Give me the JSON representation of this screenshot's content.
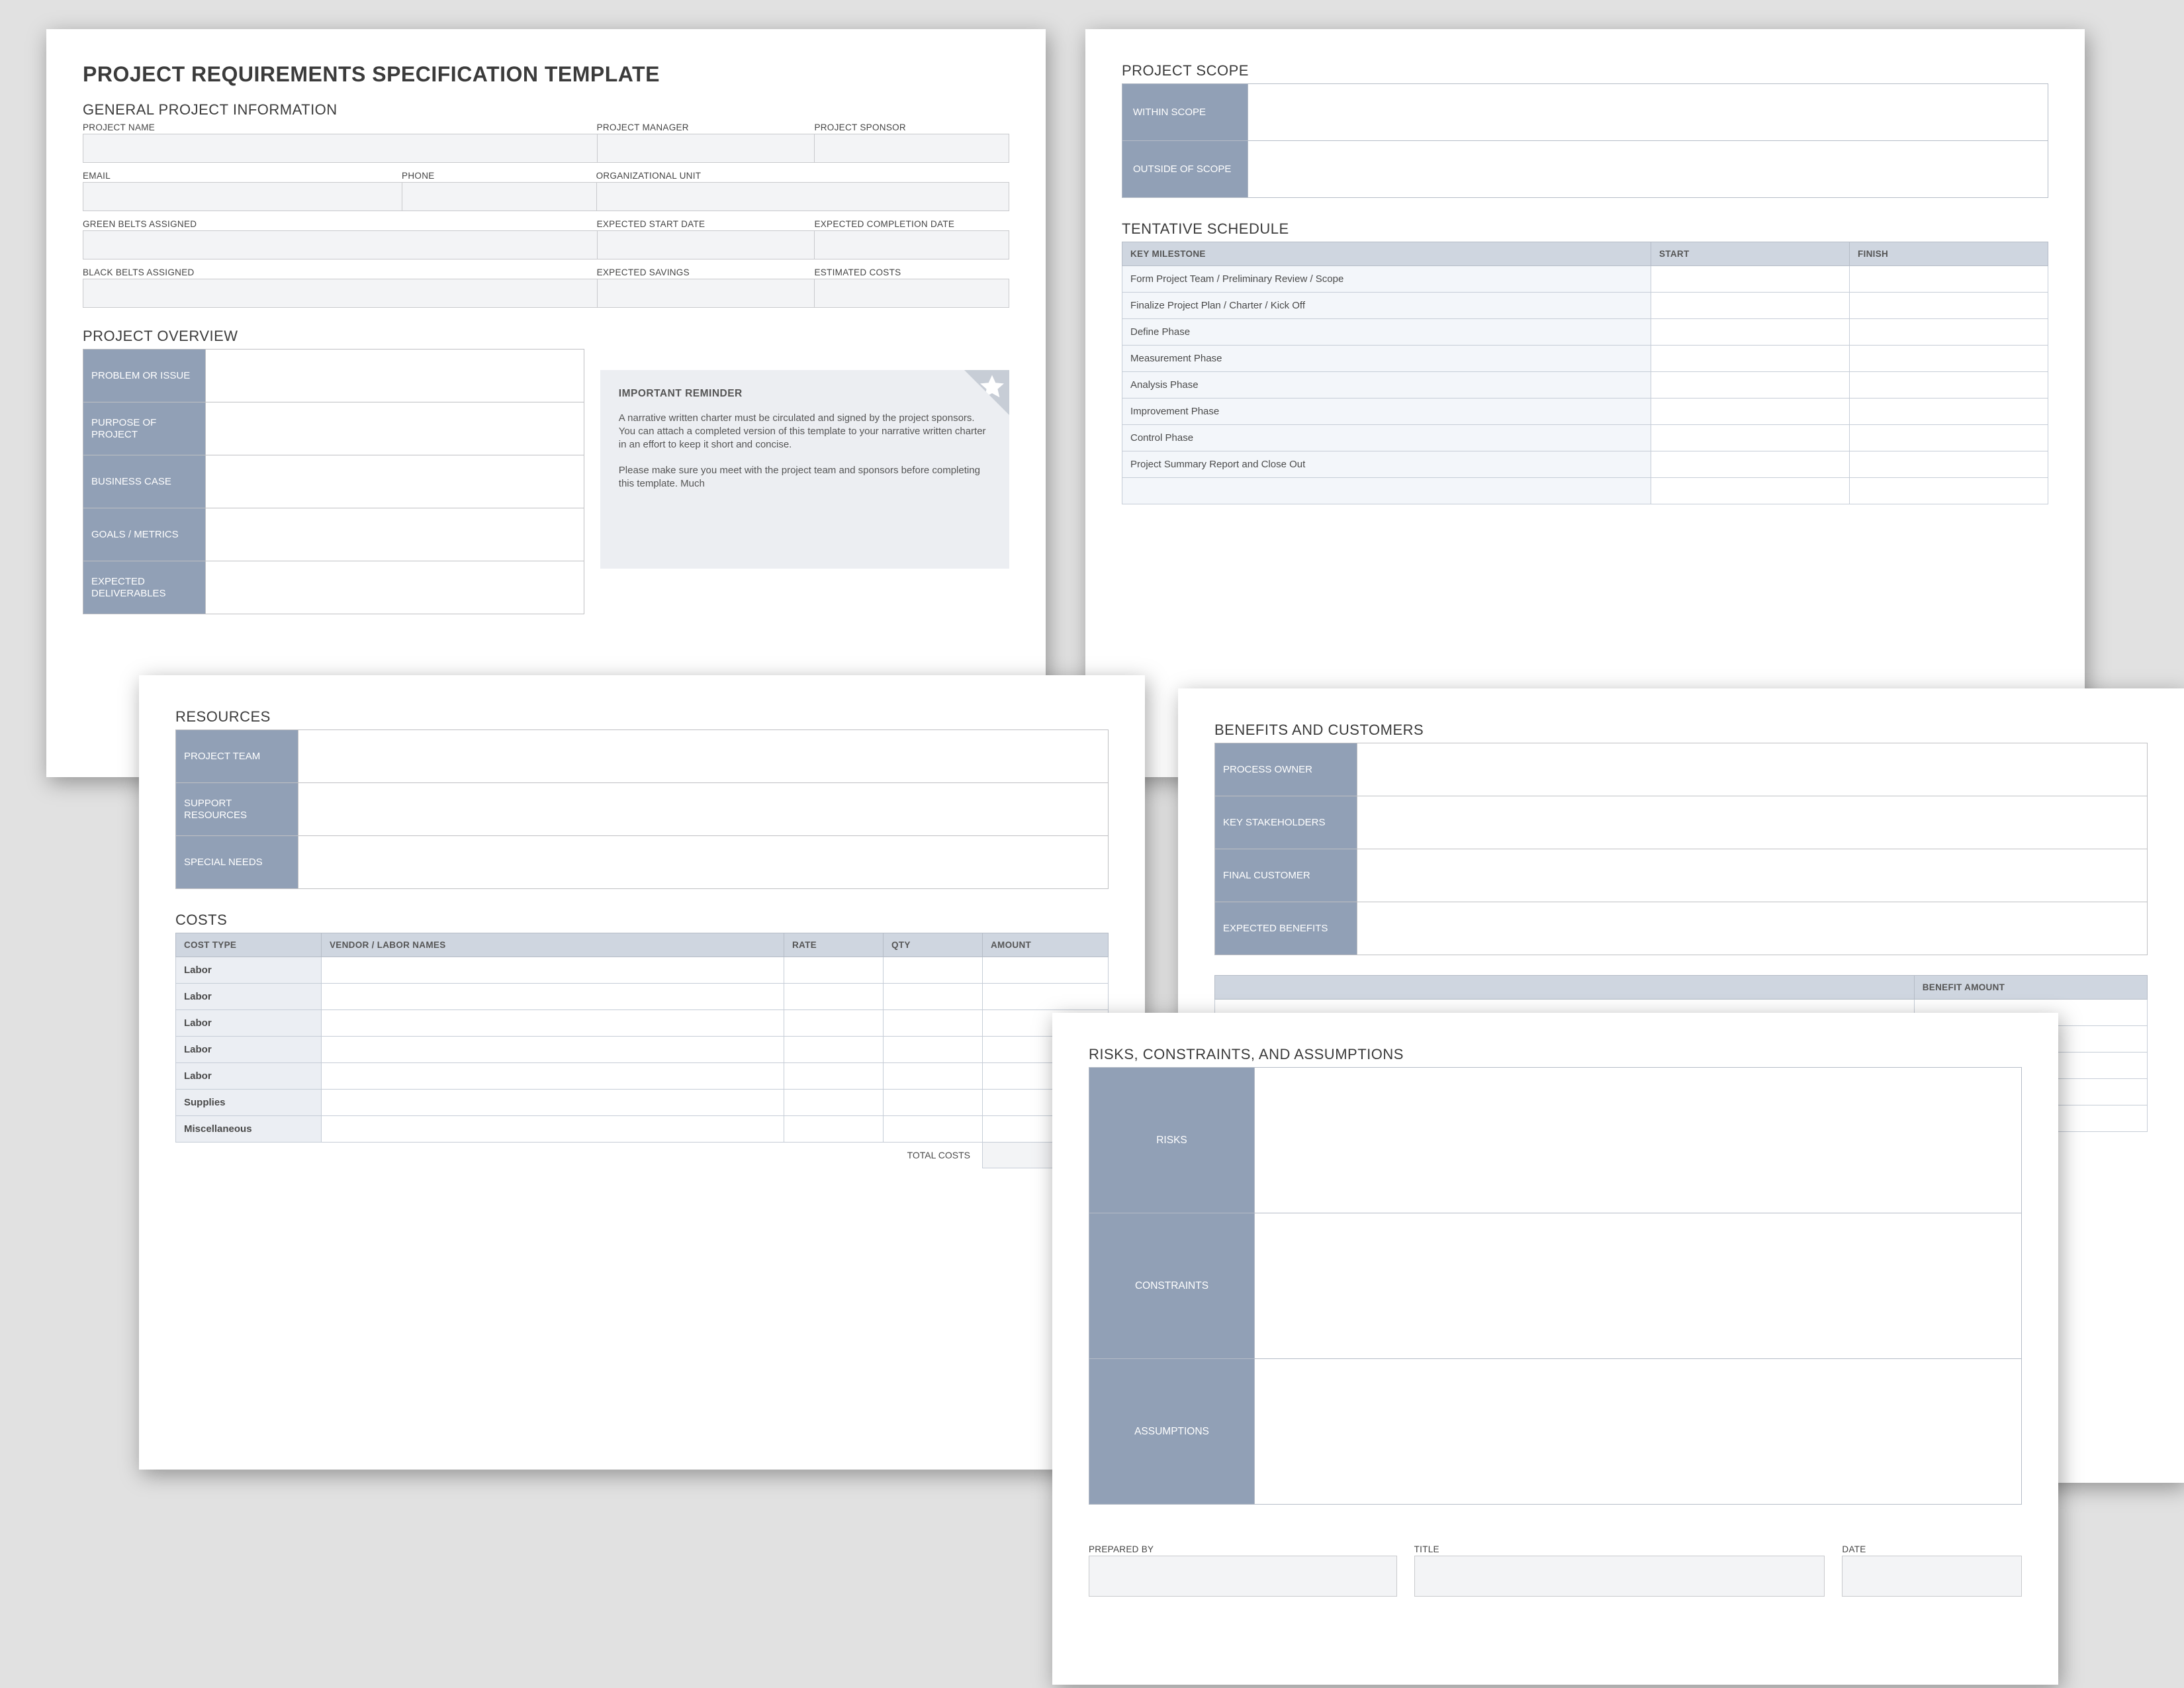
{
  "title": "PROJECT REQUIREMENTS SPECIFICATION TEMPLATE",
  "gpi": {
    "heading": "GENERAL PROJECT INFORMATION",
    "labels": {
      "project_name": "PROJECT NAME",
      "project_manager": "PROJECT MANAGER",
      "project_sponsor": "PROJECT SPONSOR",
      "email": "EMAIL",
      "phone": "PHONE",
      "org_unit": "ORGANIZATIONAL UNIT",
      "green_belts": "GREEN BELTS ASSIGNED",
      "exp_start": "EXPECTED START DATE",
      "exp_complete": "EXPECTED COMPLETION DATE",
      "black_belts": "BLACK BELTS ASSIGNED",
      "exp_savings": "EXPECTED SAVINGS",
      "est_costs": "ESTIMATED COSTS"
    }
  },
  "overview": {
    "heading": "PROJECT OVERVIEW",
    "rows": [
      "PROBLEM OR ISSUE",
      "PURPOSE OF PROJECT",
      "BUSINESS CASE",
      "GOALS / METRICS",
      "EXPECTED DELIVERABLES"
    ]
  },
  "reminder": {
    "title": "IMPORTANT REMINDER",
    "p1": "A narrative written charter must be circulated and signed by the project sponsors. You can attach a completed version of this template to your narrative written charter in an effort to keep it short and concise.",
    "p2": "Please make sure you meet with the project team and sponsors before completing this template. Much"
  },
  "scope": {
    "heading": "PROJECT SCOPE",
    "rows": [
      "WITHIN SCOPE",
      "OUTSIDE OF SCOPE"
    ]
  },
  "schedule": {
    "heading": "TENTATIVE SCHEDULE",
    "columns": [
      "KEY MILESTONE",
      "START",
      "FINISH"
    ],
    "rows": [
      "Form Project Team / Preliminary Review / Scope",
      "Finalize Project Plan / Charter / Kick Off",
      "Define Phase",
      "Measurement Phase",
      "Analysis Phase",
      "Improvement Phase",
      "Control Phase",
      "Project Summary Report and Close Out"
    ]
  },
  "resources": {
    "heading": "RESOURCES",
    "rows": [
      "PROJECT TEAM",
      "SUPPORT RESOURCES",
      "SPECIAL NEEDS"
    ]
  },
  "costs": {
    "heading": "COSTS",
    "columns": [
      "COST TYPE",
      "VENDOR / LABOR NAMES",
      "RATE",
      "QTY",
      "AMOUNT"
    ],
    "rows": [
      "Labor",
      "Labor",
      "Labor",
      "Labor",
      "Labor",
      "Supplies",
      "Miscellaneous"
    ],
    "total_label": "TOTAL COSTS"
  },
  "benefits": {
    "heading": "BENEFITS AND CUSTOMERS",
    "rows": [
      "PROCESS OWNER",
      "KEY STAKEHOLDERS",
      "FINAL CUSTOMER",
      "EXPECTED BENEFITS"
    ],
    "amount_col": "BENEFIT AMOUNT"
  },
  "risks": {
    "heading": "RISKS, CONSTRAINTS, AND ASSUMPTIONS",
    "rows": [
      "RISKS",
      "CONSTRAINTS",
      "ASSUMPTIONS"
    ]
  },
  "sign": {
    "prepared_by": "PREPARED BY",
    "title": "TITLE",
    "date": "DATE"
  }
}
